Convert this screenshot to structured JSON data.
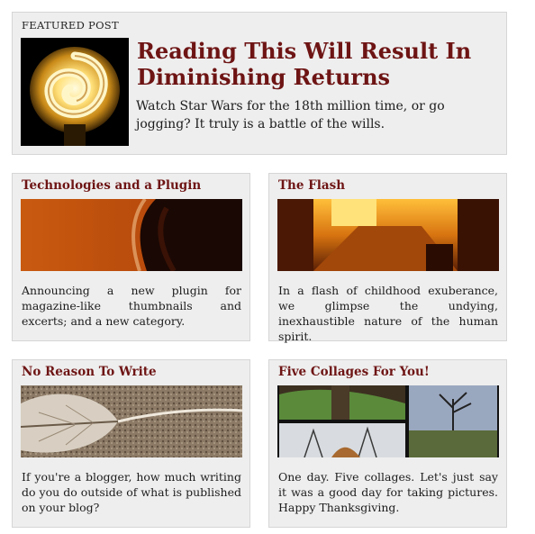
{
  "featured": {
    "label": "FEATURED POST",
    "title": "Reading This Will Result In Diminishing Returns",
    "description": "Watch Star Wars for the 18th million time, or go jogging? It truly is a battle of the wills.",
    "image_icon": "glowing-spiral-bulb-image"
  },
  "posts": [
    {
      "title": "Technologies and a Plugin",
      "description": "Announcing a new plugin for magazine-like thumbnails and excerts; and a new category.",
      "image_icon": "orange-abstract-image"
    },
    {
      "title": "The Flash",
      "description": "In a flash of childhood exuberance, we glimpse the undying, inexhaustible nature of the human spirit.",
      "image_icon": "hallway-light-image"
    },
    {
      "title": "No Reason To Write",
      "description": "If you're a blogger, how much writing do you do outside of what is published on your blog?",
      "image_icon": "sepia-leaf-image"
    },
    {
      "title": "Five Collages For You!",
      "description": "One day. Five collages. Let's just say it was a good day for taking pictures. Happy Thanksgiving.",
      "image_icon": "photo-collage-image"
    }
  ],
  "colors": {
    "title": "#6e1414",
    "panel": "#eeeeee",
    "border": "#d6d6d6"
  }
}
